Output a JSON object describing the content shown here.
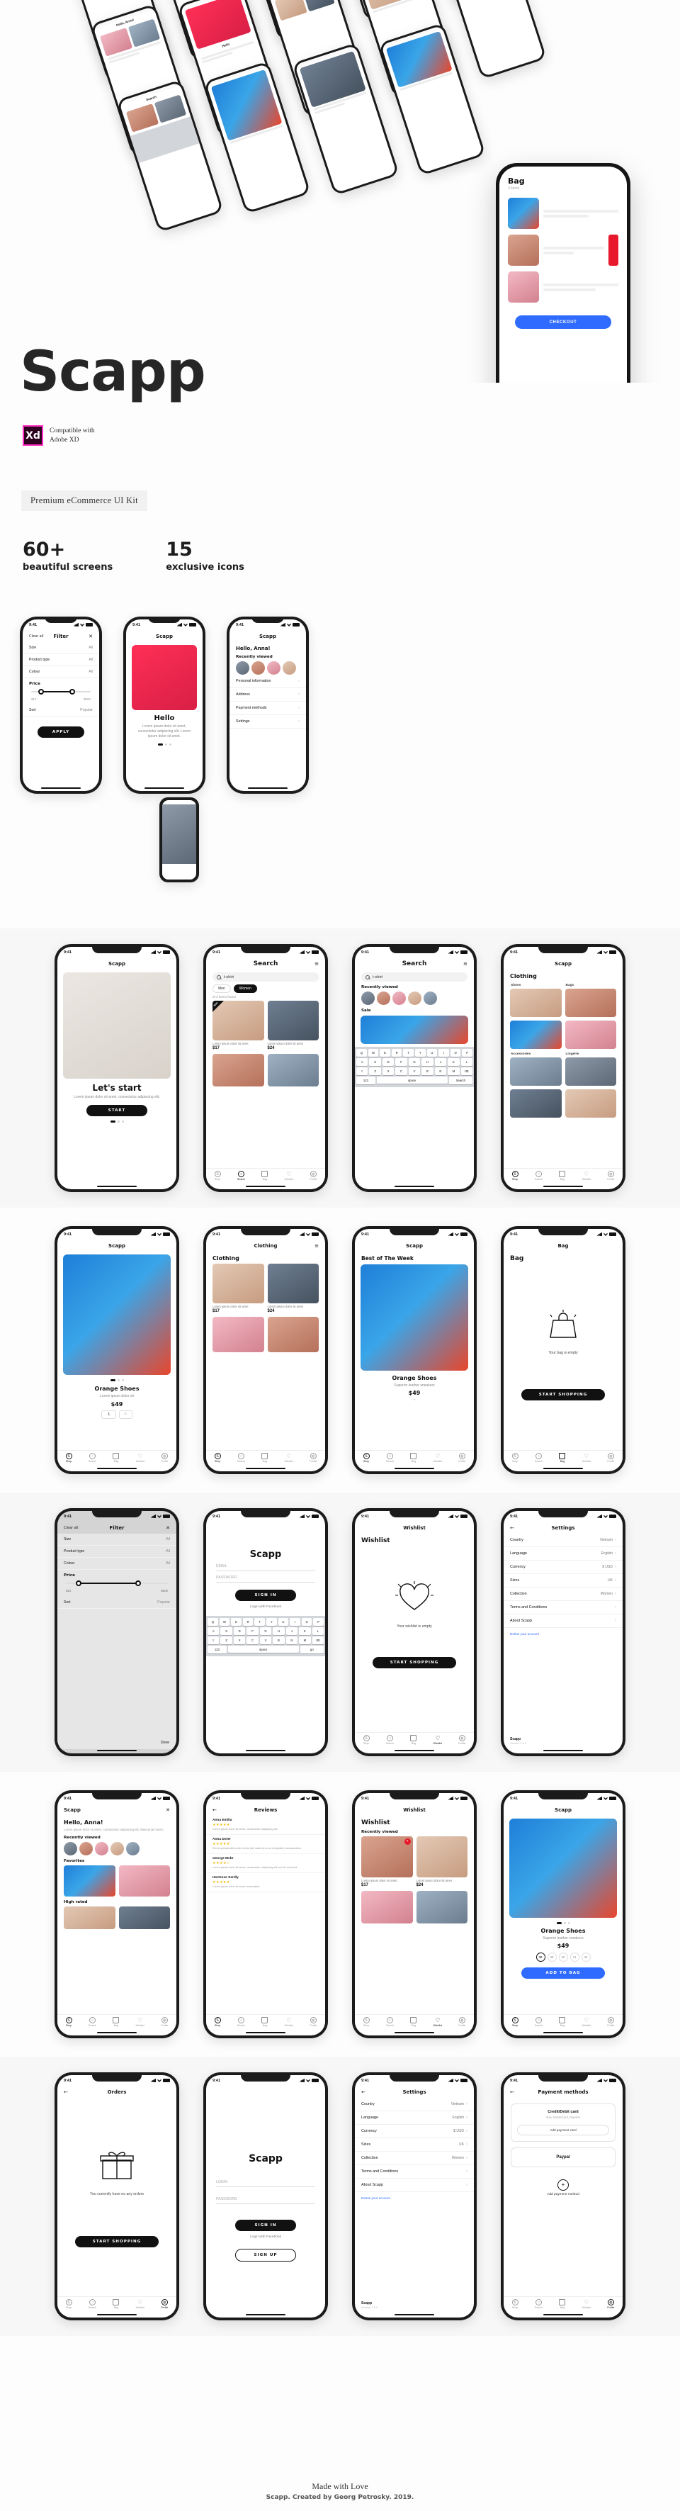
{
  "hero": {
    "title": "Scapp",
    "xd_badge": "Xd",
    "xd_line1": "Compatible with",
    "xd_line2": "Adobe XD",
    "kit_badge": "Premium eCommerce UI Kit",
    "stats": [
      {
        "num": "60+",
        "label": "beautiful screens"
      },
      {
        "num": "15",
        "label": "exclusive icons"
      }
    ]
  },
  "footer": {
    "line1": "Made with Love",
    "line2": "Scapp. Created by Georg Petrosky. 2019."
  },
  "common": {
    "status_time": "9:41",
    "brand": "Scapp",
    "tabs": [
      "Shop",
      "Search",
      "Bag",
      "Wishlist",
      "Profile"
    ]
  },
  "screens": {
    "lets_start": {
      "nav": "Scapp",
      "title": "Let's start",
      "sub": "Lorem ipsum dolor sit amet, consectetur adipiscing elit.",
      "button": "START"
    },
    "hello_trio": {
      "nav": "Scapp",
      "title": "Hello",
      "sub": "Lorem ipsum dolor sit amet, consectetur adipiscing elit. Lorem ipsum dolor sit amet."
    },
    "filter_trio": {
      "nav": "Filter",
      "clear": "Clear all",
      "rows": [
        {
          "label": "Size",
          "value": "All"
        },
        {
          "label": "Product type",
          "value": "All"
        },
        {
          "label": "Colour",
          "value": "All"
        }
      ],
      "price_label": "Price",
      "price_min": "$10",
      "price_max": "$500",
      "sort_label": "Sort",
      "sort_value": "Popular",
      "apply": "APPLY"
    },
    "hello_anna_trio": {
      "nav": "Scapp",
      "title": "Hello, Anna!",
      "section": "Recently viewed",
      "items": [
        "Personal information",
        "Address",
        "Payment methods",
        "Settings"
      ]
    },
    "search": {
      "nav": "Search",
      "query": "t-shirt",
      "placeholder": "Search",
      "chips": [
        "Men",
        "Women"
      ],
      "meta": "273 items found",
      "badge": "NEW",
      "products": [
        {
          "name": "Lorem ipsum dolor sit amet",
          "price": "$17"
        },
        {
          "name": "Lorem ipsum dolor sit amet",
          "price": "$24"
        }
      ]
    },
    "search_kb": {
      "nav": "Search",
      "query": "t-shirt",
      "section": "Recently viewed",
      "sale": "Sale",
      "keys_row1": [
        "Q",
        "W",
        "E",
        "R",
        "T",
        "Y",
        "U",
        "I",
        "O",
        "P"
      ],
      "keys_row2": [
        "A",
        "S",
        "D",
        "F",
        "G",
        "H",
        "J",
        "K",
        "L"
      ],
      "keys_row3": [
        "Z",
        "X",
        "C",
        "V",
        "B",
        "N",
        "M"
      ],
      "space": "space",
      "search_key": "Search"
    },
    "clothing_cat": {
      "nav": "Scapp",
      "title": "Clothing",
      "cats": [
        "Shoes",
        "Bags",
        "Accessories",
        "Lingerie"
      ]
    },
    "product": {
      "nav": "Scapp",
      "title": "Orange Shoes",
      "sub": "Lorem ipsum dolor sit",
      "price": "$49",
      "qty": "1"
    },
    "clothing_grid": {
      "nav": "Clothing",
      "title": "Clothing",
      "products": [
        {
          "name": "Lorem ipsum dolor sit amet",
          "price": "$17"
        },
        {
          "name": "Lorem ipsum dolor sit amet",
          "price": "$24"
        }
      ]
    },
    "best_week": {
      "nav": "Scapp",
      "title": "Best of The Week",
      "product": "Orange Shoes",
      "sub": "Superior leather sneakers",
      "price": "$49"
    },
    "bag_empty": {
      "nav": "Bag",
      "title": "Bag",
      "empty": "Your bag is empty",
      "button": "START SHOPPING"
    },
    "filter_full": {
      "nav": "Filter",
      "clear": "Clear all",
      "rows": [
        {
          "label": "Size",
          "value": "All"
        },
        {
          "label": "Product type",
          "value": "All"
        },
        {
          "label": "Colour",
          "value": "All"
        }
      ],
      "price_label": "Price",
      "price_min": "$10",
      "price_max": "$500",
      "sort_label": "Sort",
      "sort_value": "Popular",
      "done": "Done"
    },
    "signin": {
      "title": "Scapp",
      "email_placeholder": "EMAIL",
      "password_placeholder": "PASSWORD",
      "button": "SIGN IN",
      "facebook": "Login with Facebook",
      "signup": "SIGN UP"
    },
    "wishlist_empty": {
      "nav": "Wishlist",
      "title": "Wishlist",
      "empty": "Your wishlist is empty",
      "button": "START SHOPPING"
    },
    "settings": {
      "nav": "Settings",
      "rows": [
        {
          "label": "Country",
          "value": "Vietnam"
        },
        {
          "label": "Language",
          "value": "English"
        },
        {
          "label": "Currency",
          "value": "$ USD"
        },
        {
          "label": "Sizes",
          "value": "UK"
        },
        {
          "label": "Collection",
          "value": "Women"
        },
        {
          "label": "Terms and Conditions",
          "value": ""
        },
        {
          "label": "About Scapp",
          "value": ""
        }
      ],
      "delete": "Delete your account",
      "app_name": "Scapp",
      "version": "Version 1.0.0"
    },
    "home_anna": {
      "nav": "Scapp",
      "title": "Hello, Anna!",
      "sub": "Lorem ipsum dolor sit amet, consectetur adipiscing elit. Maecenas lorem.",
      "s1": "Recently viewed",
      "s2": "Favorites",
      "s3": "High rated"
    },
    "reviews": {
      "nav": "Reviews",
      "title": "Reviews",
      "list": [
        {
          "name": "Anna Emilia",
          "text": "Lorem ipsum dolor sit amet, consectetur adipiscing elit."
        },
        {
          "name": "Anna Doter",
          "text": "Sed ut perspiciatis unde omnis iste natus error sit voluptatem accusantium."
        },
        {
          "name": "George Mcbr",
          "text": "Lorem ipsum dolor sit amet, consectetur adipiscing elit sed do eiusmod."
        },
        {
          "name": "Hortense Serdly",
          "text": "Lorem ipsum dolor sit amet consectetur."
        }
      ]
    },
    "wishlist_items": {
      "nav": "Wishlist",
      "title": "Wishlist",
      "section": "Recently viewed",
      "products": [
        {
          "name": "Lorem ipsum dolor sit amet",
          "price": "$17"
        },
        {
          "name": "Lorem ipsum dolor sit amet",
          "price": "$24"
        }
      ]
    },
    "product_detail": {
      "nav": "Scapp",
      "title": "Orange Shoes",
      "sub": "Superior leather sneakers",
      "price": "$49",
      "sizes": [
        "38",
        "39",
        "40",
        "41",
        "42"
      ],
      "button": "ADD TO BAG"
    },
    "orders_empty": {
      "nav": "Orders",
      "empty": "You currently have no any orders",
      "button": "START SHOPPING"
    },
    "login2": {
      "title": "Scapp",
      "email_placeholder": "LOGIN",
      "password_placeholder": "PASSWORD",
      "button": "SIGN IN",
      "facebook": "Login with Facebook",
      "signup": "SIGN UP"
    },
    "settings2": {
      "nav": "Settings",
      "rows": [
        {
          "label": "Country",
          "value": "Vietnam"
        },
        {
          "label": "Language",
          "value": "English"
        },
        {
          "label": "Currency",
          "value": "$ USD"
        },
        {
          "label": "Sizes",
          "value": "UK"
        },
        {
          "label": "Collection",
          "value": "Women"
        },
        {
          "label": "Terms and Conditions",
          "value": ""
        },
        {
          "label": "About Scapp",
          "value": ""
        }
      ],
      "delete": "Delete your account",
      "app_name": "Scapp",
      "version": "Version 1.0.0"
    },
    "payment": {
      "nav": "Payment methods",
      "card": "Credit/Debit card",
      "card_sub": "Visa, Mastercard, Maestro",
      "add_card": "Add payment card",
      "paypal": "Paypal",
      "add_method": "Add payment method"
    }
  }
}
